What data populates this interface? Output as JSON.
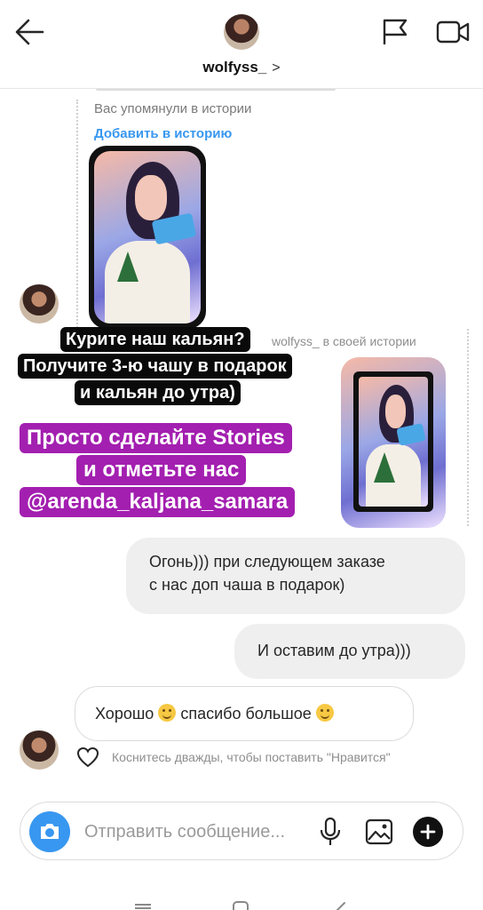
{
  "header": {
    "username": "wolfyss_",
    "chevron": ">"
  },
  "thread": {
    "mention_notice": "Вас упомянули в истории",
    "add_to_story": "Добавить в историю",
    "reply_label": "wolfyss_ в своей истории",
    "story_caption_black": [
      "Курите наш кальян?",
      "Получите 3-ю чашу в подарок",
      "и кальян до утра)"
    ],
    "story_caption_purple": [
      "Просто сделайте Stories",
      "и отметьте нас",
      "@arenda_kaljana_samara"
    ],
    "messages": [
      {
        "line1": "Огонь))) при следующем заказе",
        "line2": "с нас доп чаша в подарок)"
      },
      {
        "text": "И оставим до утра)))"
      },
      {
        "part1": "Хорошо",
        "part2": "спасибо большое"
      }
    ],
    "like_hint": "Коснитесь дважды, чтобы поставить \"Нравится\""
  },
  "composer": {
    "placeholder": "Отправить сообщение..."
  },
  "icons": {
    "back": "arrow-left-icon",
    "flag": "flag-icon",
    "video": "video-camera-icon",
    "camera": "camera-icon",
    "mic": "microphone-icon",
    "gallery": "image-icon",
    "plus": "plus-icon",
    "heart": "heart-icon"
  },
  "colors": {
    "link": "#3897f0",
    "caption_purple": "#a31fb0",
    "caption_black": "#0a0a0a",
    "outgoing_bubble": "#efefef"
  }
}
